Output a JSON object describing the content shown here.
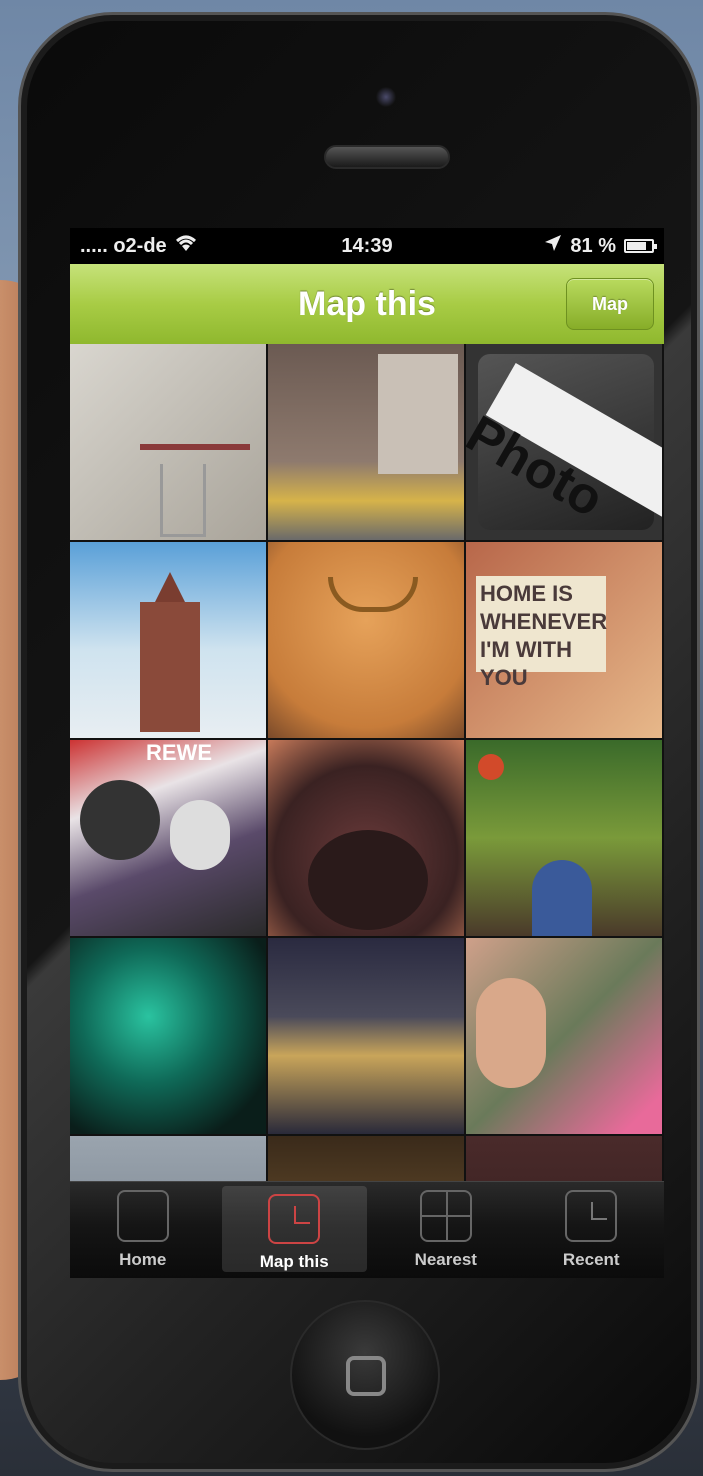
{
  "status": {
    "carrier": "..... o2-de",
    "time": "14:39",
    "battery": "81 %",
    "battery_level": 0.81
  },
  "navbar": {
    "title": "Map this",
    "map_button": "Map"
  },
  "photos": [
    {
      "cap": ""
    },
    {
      "cap": ""
    },
    {
      "cap": "Photo"
    },
    {
      "cap": ""
    },
    {
      "cap": ""
    },
    {
      "cap": "HOME IS WHENEVER I'M WITH YOU"
    },
    {
      "cap": "REWE"
    },
    {
      "cap": ""
    },
    {
      "cap": ""
    },
    {
      "cap": ""
    },
    {
      "cap": ""
    },
    {
      "cap": ""
    },
    {
      "cap": ""
    },
    {
      "cap": ""
    },
    {
      "cap": ""
    }
  ],
  "tabs": [
    {
      "label": "Home"
    },
    {
      "label": "Map this"
    },
    {
      "label": "Nearest"
    },
    {
      "label": "Recent"
    }
  ]
}
